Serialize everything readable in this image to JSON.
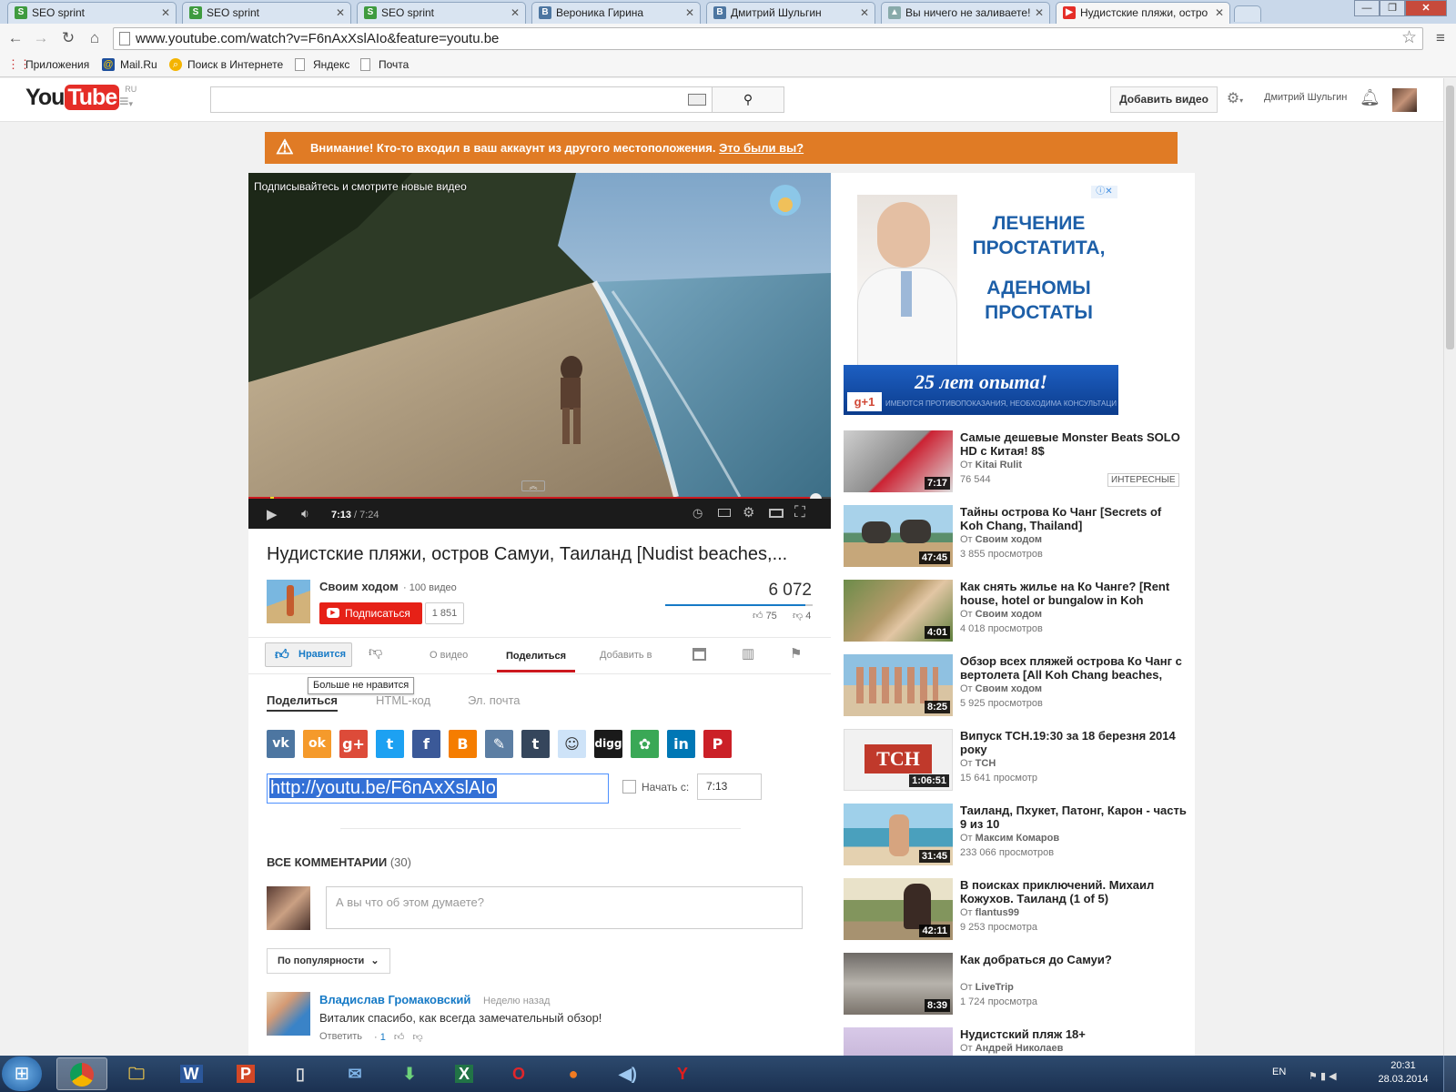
{
  "browser": {
    "tabs": [
      {
        "title": "SEO sprint",
        "favicon": "seosprint"
      },
      {
        "title": "SEO sprint",
        "favicon": "seosprint"
      },
      {
        "title": "SEO sprint",
        "favicon": "seosprint"
      },
      {
        "title": "Вероника Гирина",
        "favicon": "vk"
      },
      {
        "title": "Дмитрий Шульгин",
        "favicon": "vk"
      },
      {
        "title": "Вы ничего не заливаете!",
        "favicon": "generic"
      },
      {
        "title": "Нудистские пляжи, остро",
        "favicon": "youtube",
        "active": true
      }
    ],
    "url": "www.youtube.com/watch?v=F6nAxXslAIo&feature=youtu.be",
    "bookmarks": [
      "Приложения",
      "Mail.Ru",
      "Поиск в Интернете",
      "Яндекс",
      "Почта"
    ]
  },
  "header": {
    "logo_you": "You",
    "logo_tube": "Tube",
    "logo_region": "RU",
    "search_value": "",
    "upload_label": "Добавить видео",
    "username": "Дмитрий Шульгин"
  },
  "alert": {
    "text": "Внимание! Кто-то входил в ваш аккаунт из другого местоположения.",
    "link": "Это были вы?"
  },
  "player": {
    "overlay_title": "Подписывайтесь и смотрите новые видео",
    "current_time": "7:13",
    "duration": "/ 7:24",
    "progress": 0.974
  },
  "video": {
    "title": "Нудистские пляжи, остров Самуи, Таиланд [Nudist beaches,...",
    "channel": "Своим ходом",
    "channel_videos": "100 видео",
    "subscribe_label": "Подписаться",
    "subscribers": "1 851",
    "views": "6 072",
    "likes": "75",
    "dislikes": "4",
    "like_ratio": 0.95
  },
  "actions": {
    "like_label": "Нравится",
    "tooltip": "Больше не нравится",
    "tabs": [
      "О видео",
      "Поделиться",
      "Добавить в"
    ],
    "active_tab": "Поделиться"
  },
  "share": {
    "subtabs": [
      "Поделиться",
      "HTML-код",
      "Эл. почта"
    ],
    "services": [
      {
        "name": "vk",
        "color": "#4d76a1",
        "glyph": "vk"
      },
      {
        "name": "odnoklassniki",
        "color": "#f59a2b",
        "glyph": "ok"
      },
      {
        "name": "google-plus",
        "color": "#dd4b39",
        "glyph": "g+"
      },
      {
        "name": "twitter",
        "color": "#1da1f2",
        "glyph": "t"
      },
      {
        "name": "facebook",
        "color": "#3b5998",
        "glyph": "f"
      },
      {
        "name": "blogger",
        "color": "#f57d00",
        "glyph": "B"
      },
      {
        "name": "livejournal",
        "color": "#5c7ea3",
        "glyph": "✎"
      },
      {
        "name": "tumblr",
        "color": "#35465c",
        "glyph": "t"
      },
      {
        "name": "reddit",
        "color": "#cee3f8",
        "glyph": "☺"
      },
      {
        "name": "digg",
        "color": "#1a1a1a",
        "glyph": "digg"
      },
      {
        "name": "stumbleupon",
        "color": "#3aa856",
        "glyph": "✿"
      },
      {
        "name": "linkedin",
        "color": "#0077b5",
        "glyph": "in"
      },
      {
        "name": "pinterest",
        "color": "#cb2027",
        "glyph": "P"
      }
    ],
    "url": "http://youtu.be/F6nAxXslAIo",
    "start_label": "Начать с:",
    "start_time": "7:13"
  },
  "comments": {
    "header": "ВСЕ КОММЕНТАРИИ",
    "count": "(30)",
    "placeholder": "А вы что об этом думаете?",
    "sort_label": "По популярности",
    "items": [
      {
        "author": "Владислав Громаковский",
        "time": "Неделю назад",
        "text": "Виталик спасибо, как всегда замечательный обзор!",
        "reply": "Ответить",
        "likes": "1"
      }
    ]
  },
  "ad": {
    "line1": "ЛЕЧЕНИЕ",
    "line2": "ПРОСТАТИТА,",
    "line3": "АДЕНОМЫ",
    "line4": "ПРОСТАТЫ",
    "banner": "25 лет опыта!",
    "badge": "g+1",
    "fineprint": "ИМЕЮТСЯ ПРОТИВОПОКАЗАНИЯ, НЕОБХОДИМА КОНСУЛЬТАЦИЯ СПЕЦИАЛИСТА"
  },
  "related": [
    {
      "title": "Самые дешевые Monster Beats SOLO HD с Китая! 8$",
      "by_label": "От",
      "author": "Kitai Rulit",
      "views": "76 544",
      "duration": "7:17",
      "badge": "ИНТЕРЕСНЫЕ"
    },
    {
      "title": "Тайны острова Ко Чанг [Secrets of Koh Chang, Thailand]",
      "by_label": "От",
      "author": "Своим ходом",
      "views": "3 855 просмотров",
      "duration": "47:45"
    },
    {
      "title": "Как снять жилье на Ко Чанге? [Rent house, hotel or bungalow in Koh",
      "by_label": "От",
      "author": "Своим ходом",
      "views": "4 018 просмотров",
      "duration": "4:01"
    },
    {
      "title": "Обзор всех пляжей острова Ко Чанг с вертолета [All Koh Chang beaches,",
      "by_label": "От",
      "author": "Своим ходом",
      "views": "5 925 просмотров",
      "duration": "8:25"
    },
    {
      "title": "Випуск ТСН.19:30 за 18 березня 2014 року",
      "by_label": "От",
      "author": "ТСН",
      "views": "15 641 просмотр",
      "duration": "1:06:51"
    },
    {
      "title": "Таиланд, Пхукет, Патонг, Карон - часть 9 из 10",
      "by_label": "От",
      "author": "Максим Комаров",
      "views": "233 066 просмотров",
      "duration": "31:45"
    },
    {
      "title": "В поисках приключений. Михаил Кожухов. Таиланд (1 of 5)",
      "by_label": "От",
      "author": "flantus99",
      "views": "9 253 просмотра",
      "duration": "42:11"
    },
    {
      "title": "Как добраться до Самуи?",
      "by_label": "От",
      "author": "LiveTrip",
      "views": "1 724 просмотра",
      "duration": "8:39"
    },
    {
      "title": "Нудистский пляж 18+",
      "by_label": "От",
      "author": "Андрей Николаев",
      "views": "",
      "duration": ""
    }
  ],
  "taskbar": {
    "lang": "EN",
    "time": "20:31",
    "date": "28.03.2014"
  }
}
